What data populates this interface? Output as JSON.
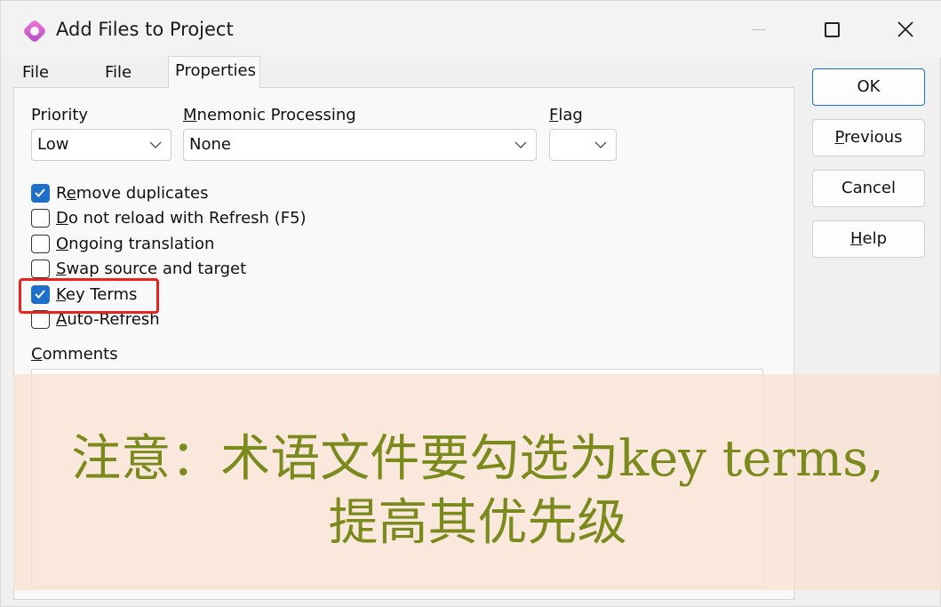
{
  "window": {
    "title": "Add Files to Project"
  },
  "tabs": [
    {
      "label": "File Type",
      "active": false
    },
    {
      "label": "File List",
      "active": false
    },
    {
      "label": "Properties",
      "active": true
    }
  ],
  "priority": {
    "label": "Priority",
    "value": "Low"
  },
  "mnemonic": {
    "label_accel": "M",
    "label_rest": "nemonic Processing",
    "value": "None"
  },
  "flag": {
    "label_accel": "F",
    "label_rest": "lag",
    "value": ""
  },
  "options": [
    {
      "pre": "R",
      "accel": "e",
      "post": "move duplicates",
      "checked": true
    },
    {
      "pre": "",
      "accel": "D",
      "post": "o not reload with Refresh (F5)",
      "checked": false
    },
    {
      "pre": "",
      "accel": "O",
      "post": "ngoing translation",
      "checked": false
    },
    {
      "pre": "",
      "accel": "S",
      "post": "wap source and target",
      "checked": false
    },
    {
      "pre": "",
      "accel": "K",
      "post": "ey Terms",
      "checked": true
    },
    {
      "pre": "",
      "accel": "A",
      "post": "uto-Refresh",
      "checked": false
    }
  ],
  "comments": {
    "label_accel": "C",
    "label_rest": "omments",
    "value": ""
  },
  "buttons": {
    "ok": "OK",
    "previous_accel": "P",
    "previous_rest": "revious",
    "cancel": "Cancel",
    "help_accel": "H",
    "help_rest": "elp"
  },
  "annotation": {
    "line1": "注意：术语文件要勾选为key terms,",
    "line2": "提高其优先级",
    "highlight_color": "#e8231f"
  },
  "colors": {
    "accent": "#1d6fc9",
    "note_text": "#7a8a1c"
  }
}
